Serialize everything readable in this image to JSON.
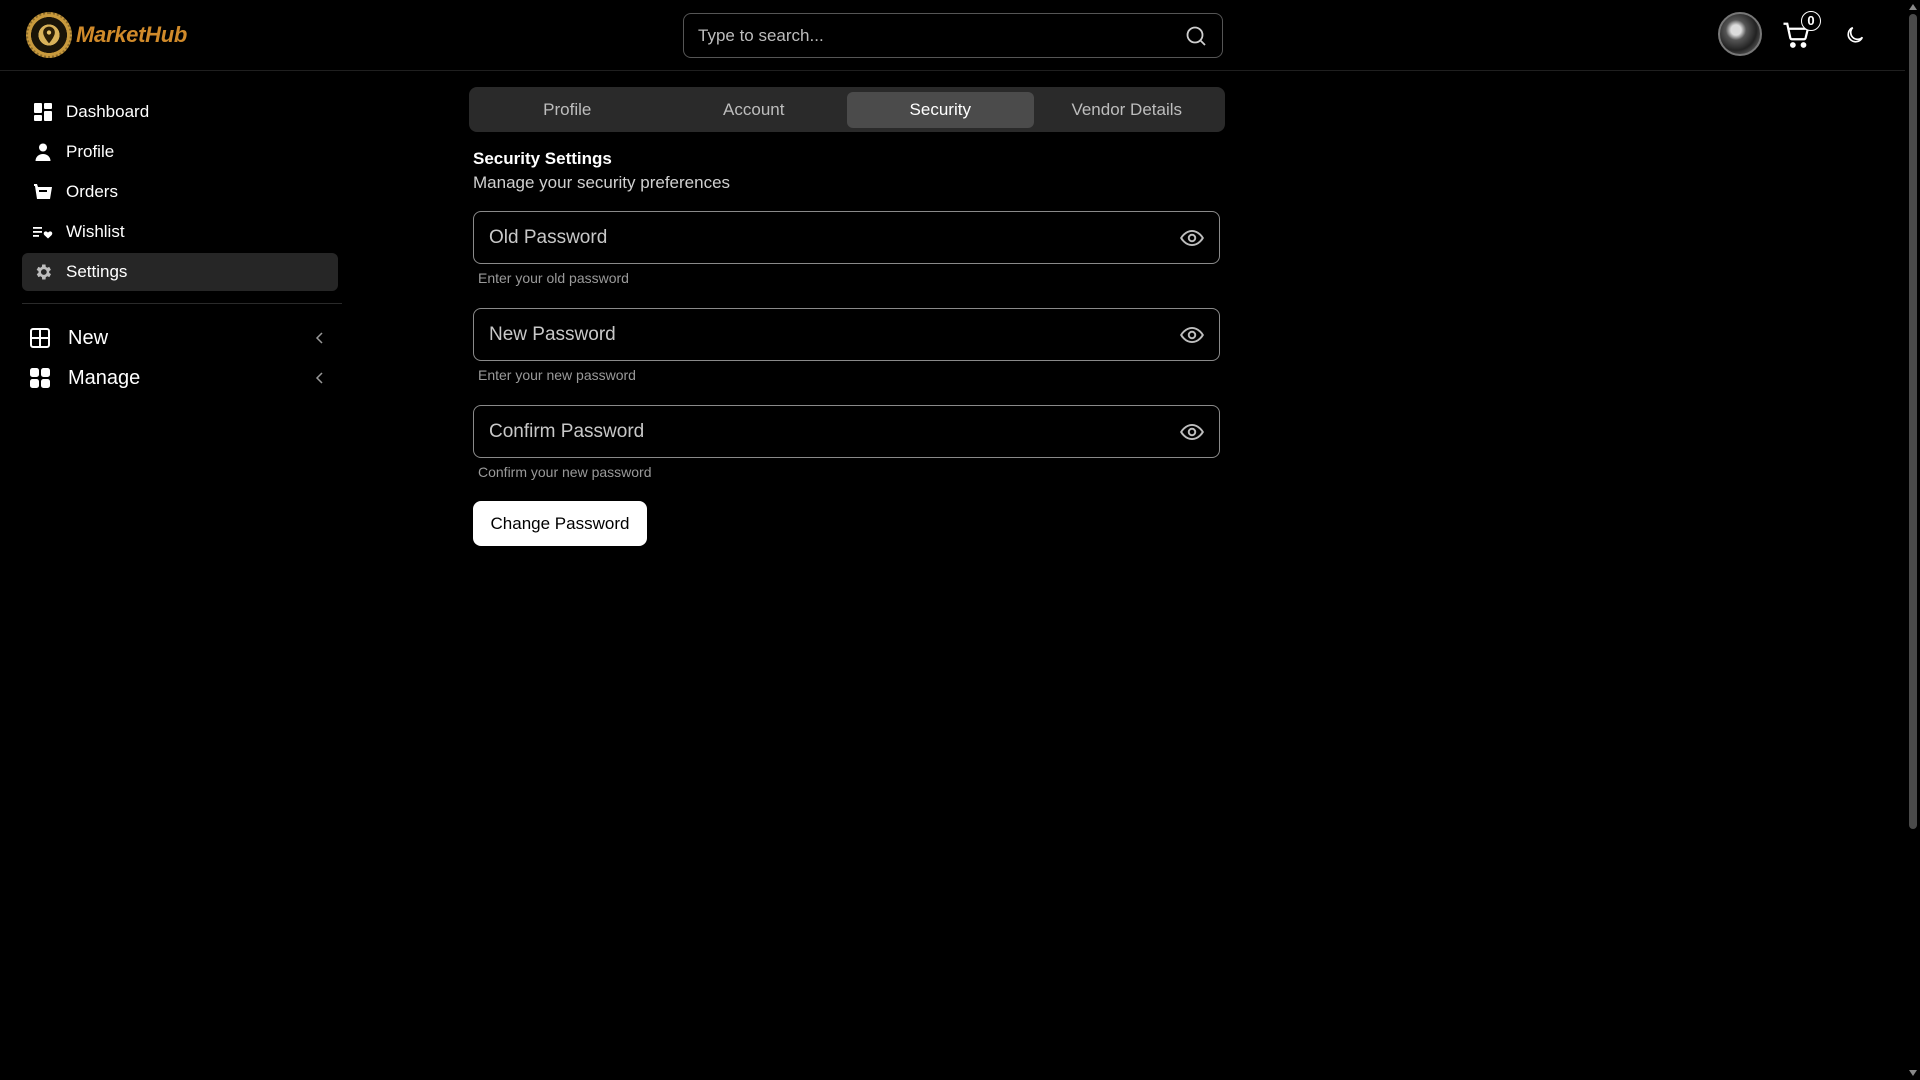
{
  "brand": {
    "name": "MarketHub"
  },
  "search": {
    "placeholder": "Type to search..."
  },
  "cart": {
    "count": "0"
  },
  "sidebar": {
    "items": [
      {
        "label": "Dashboard",
        "icon": "dashboard-icon"
      },
      {
        "label": "Profile",
        "icon": "user-icon"
      },
      {
        "label": "Orders",
        "icon": "basket-icon"
      },
      {
        "label": "Wishlist",
        "icon": "wishlist-icon"
      },
      {
        "label": "Settings",
        "icon": "gear-icon",
        "active": true
      }
    ],
    "groups": [
      {
        "label": "New",
        "icon": "plus-square-icon"
      },
      {
        "label": "Manage",
        "icon": "grid-icon"
      }
    ]
  },
  "tabs": [
    {
      "label": "Profile"
    },
    {
      "label": "Account"
    },
    {
      "label": "Security",
      "active": true
    },
    {
      "label": "Vendor Details"
    }
  ],
  "security": {
    "title": "Security Settings",
    "subtitle": "Manage your security preferences",
    "fields": [
      {
        "placeholder": "Old Password",
        "helper": "Enter your old password"
      },
      {
        "placeholder": "New Password",
        "helper": "Enter your new password"
      },
      {
        "placeholder": "Confirm Password",
        "helper": "Confirm your new password"
      }
    ],
    "submit_label": "Change Password"
  },
  "colors": {
    "brand": "#d08a2a",
    "background": "#000000",
    "active_tab": "#4b4b4b"
  }
}
